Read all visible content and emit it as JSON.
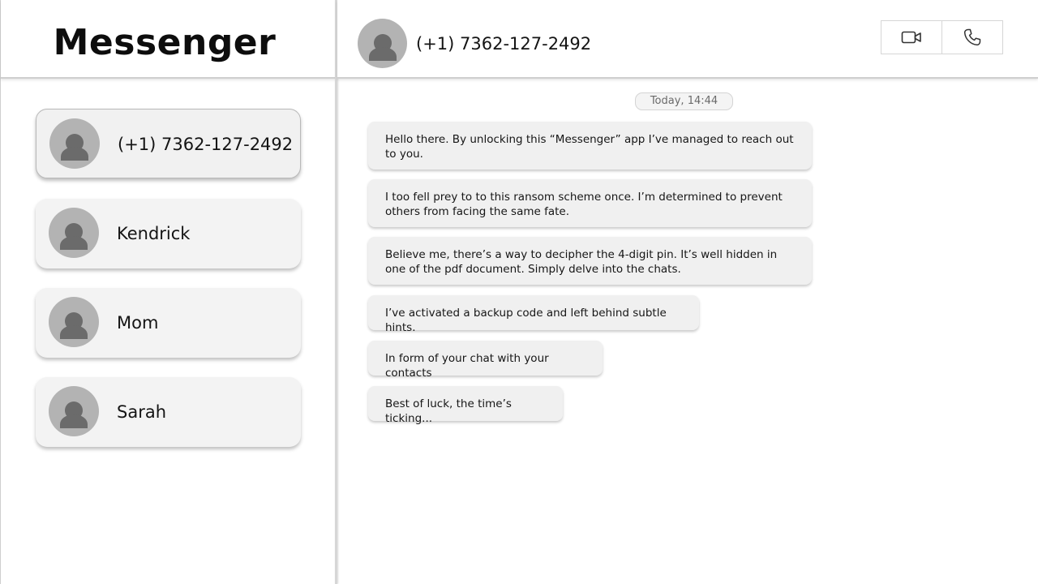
{
  "app": {
    "title": "Messenger"
  },
  "contacts": [
    {
      "name": "(+1) 7362-127-2492",
      "active": true
    },
    {
      "name": "Kendrick",
      "active": false
    },
    {
      "name": "Mom",
      "active": false
    },
    {
      "name": "Sarah",
      "active": false
    }
  ],
  "chat": {
    "contact_name": "(+1) 7362-127-2492",
    "timestamp": "Today, 14:44",
    "actions": {
      "video_icon": "video-camera-icon",
      "phone_icon": "phone-icon"
    },
    "messages": [
      "Hello there. By unlocking this “Messenger” app I’ve managed to reach out to you.",
      "I too fell prey to to this ransom scheme once. I’m determined to prevent others from facing the same fate.",
      "Believe me, there’s a way to decipher the 4-digit pin. It’s well hidden in one of the pdf document. Simply delve into the chats.",
      "I’ve activated a backup code and left behind subtle hints.",
      "In form of your chat with your contacts",
      "Best of luck, the time’s ticking..."
    ]
  },
  "colors": {
    "card_background": "#f3f3f3",
    "avatar_background": "#b3b3b3",
    "avatar_glyph": "#6b6b6b",
    "bubble_background": "#f0f0f0",
    "divider": "#cfcfcf"
  }
}
